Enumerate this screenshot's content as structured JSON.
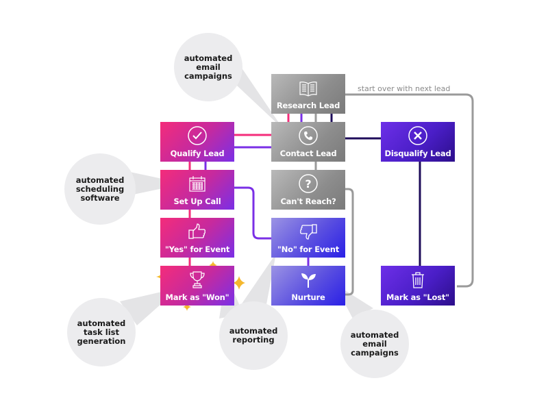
{
  "nodes": {
    "research_lead": {
      "label": "Research Lead",
      "icon": "book-icon"
    },
    "contact_lead": {
      "label": "Contact Lead",
      "icon": "phone-icon"
    },
    "qualify_lead": {
      "label": "Qualify Lead",
      "icon": "checkmark-icon"
    },
    "disqualify_lead": {
      "label": "Disqualify Lead",
      "icon": "x-circle-icon"
    },
    "set_up_call": {
      "label": "Set Up Call",
      "icon": "calendar-icon"
    },
    "cant_reach": {
      "label": "Can't Reach?",
      "icon": "question-icon"
    },
    "yes_for_event": {
      "label": "\"Yes\" for  Event",
      "icon": "thumbs-up-icon"
    },
    "no_for_event": {
      "label": "\"No\" for Event",
      "icon": "thumbs-down-icon"
    },
    "mark_won": {
      "label": "Mark as \"Won\"",
      "icon": "trophy-icon"
    },
    "nurture": {
      "label": "Nurture",
      "icon": "sprout-icon"
    },
    "mark_lost": {
      "label": "Mark as \"Lost\"",
      "icon": "trash-icon"
    }
  },
  "notes": {
    "start_over": "start over with next lead"
  },
  "bubbles": {
    "email_top": [
      "automated",
      "email",
      "campaigns"
    ],
    "scheduling": [
      "automated",
      "scheduling",
      "software"
    ],
    "task_list": [
      "automated",
      "task list",
      "generation"
    ],
    "reporting": [
      "automated",
      "reporting"
    ],
    "email_bottom": [
      "automated",
      "email",
      "campaigns"
    ]
  },
  "colors": {
    "pink": "#f42c7a",
    "purple": "#7a2fe6",
    "violet": "#4a1ec7",
    "navy": "#1e0c5a",
    "gray": "#9a9a9a",
    "gold": "#f5b82e",
    "bubble": "#ececee"
  }
}
